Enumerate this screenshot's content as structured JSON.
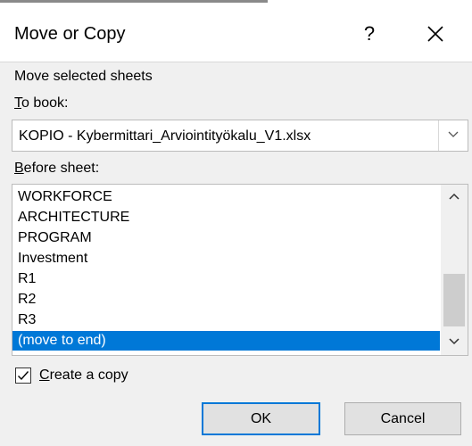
{
  "dialog": {
    "title": "Move or Copy",
    "help_label": "?",
    "close_icon": "close-icon"
  },
  "form": {
    "heading": "Move selected sheets",
    "to_book_label": {
      "accel": "T",
      "rest": "o book:"
    },
    "to_book_value": "KOPIO - Kybermittari_Arviointityökalu_V1.xlsx",
    "before_sheet_label": {
      "accel": "B",
      "rest": "efore sheet:"
    },
    "sheets": [
      "WORKFORCE",
      "ARCHITECTURE",
      "PROGRAM",
      "Investment",
      "R1",
      "R2",
      "R3",
      "(move to end)"
    ],
    "selected_sheet": "(move to end)",
    "create_copy_label": {
      "accel": "C",
      "rest": "reate a copy"
    },
    "create_copy_checked": true
  },
  "buttons": {
    "ok": "OK",
    "cancel": "Cancel"
  },
  "colors": {
    "selection": "#0078d7",
    "dialog_bg": "#f0f0f0"
  }
}
